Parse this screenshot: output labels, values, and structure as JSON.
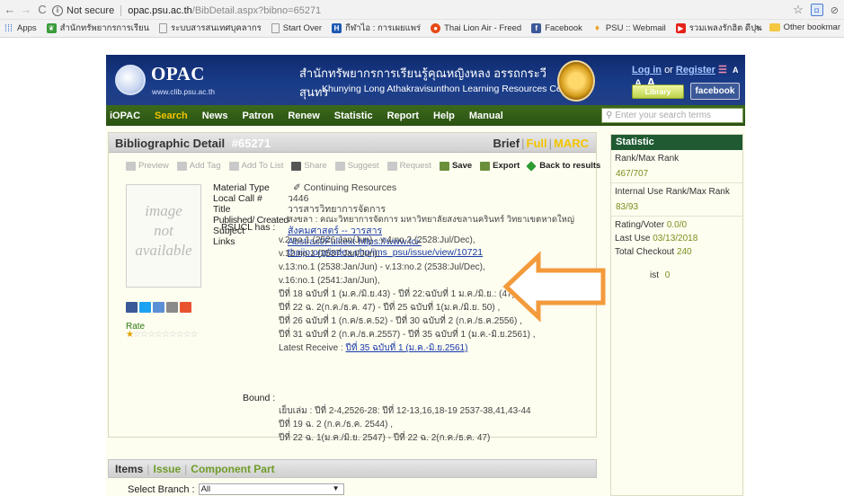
{
  "browser": {
    "nav_back": "←",
    "nav_forward": "→",
    "reload": "C",
    "security_label": "Not secure",
    "url_host": "opac.psu.ac.th",
    "url_path": "/BibDetail.aspx?bibno=65271",
    "bookmarks": [
      {
        "label": "Apps",
        "icon": "apps-grid-icon",
        "color": "#4a7bd0"
      },
      {
        "label": "สำนักทรัพยากรการเรียน",
        "icon": "leaf-icon",
        "color": "#3a9c3a"
      },
      {
        "label": "ระบบสารสนเทศบุคลากร",
        "icon": "page-icon",
        "color": "#999999"
      },
      {
        "label": "Start Over",
        "icon": "page-icon",
        "color": "#999999"
      },
      {
        "label": "กีฬาไอ : การเผยแพร่",
        "icon": "h-icon",
        "color": "#1e5ab4"
      },
      {
        "label": "Thai Lion Air - Freed",
        "icon": "lion-icon",
        "color": "#e64a19"
      },
      {
        "label": "Facebook",
        "icon": "facebook-icon",
        "color": "#3b5998"
      },
      {
        "label": "PSU :: Webmail",
        "icon": "psu-icon",
        "color": "#f0a020"
      },
      {
        "label": "รวมเพลงรักฮิต ดีปุน",
        "icon": "youtube-icon",
        "color": "#e62117"
      }
    ],
    "overflow": "»",
    "other_bookmarks": "Other bookmar"
  },
  "header": {
    "logo_title": "OPAC",
    "logo_url": "www.clib.psu.ac.th",
    "center_thai": "สำนักทรัพยากรการเรียนรู้คุณหญิงหลง อรรถกระวีสุนทร",
    "center_en": "Khunying Long Athakravisunthon Learning Resources Center",
    "login": "Log in",
    "or": "or",
    "register": "Register",
    "font_sizes": [
      "A",
      "A",
      "A"
    ],
    "library_badge": "Library",
    "facebook_badge": "facebook"
  },
  "menu": {
    "items": [
      "iOPAC",
      "Search",
      "News",
      "Patron",
      "Renew",
      "Statistic",
      "Report",
      "Help",
      "Manual"
    ],
    "active": "Search",
    "search_placeholder": "Enter your search terms"
  },
  "bib": {
    "title": "Bibliographic Detail",
    "bib_number": "#65271",
    "views": [
      "Brief",
      "Full",
      "MARC"
    ],
    "actions": [
      {
        "label": "Preview",
        "enabled": false
      },
      {
        "label": "Add Tag",
        "enabled": false
      },
      {
        "label": "Add To List",
        "enabled": false
      },
      {
        "label": "Share",
        "enabled": false
      },
      {
        "label": "Suggest",
        "enabled": false
      },
      {
        "label": "Request",
        "enabled": false
      },
      {
        "label": "Save",
        "enabled": true
      },
      {
        "label": "Export",
        "enabled": true
      },
      {
        "label": "Back to results",
        "enabled": true
      }
    ],
    "no_image": [
      "image",
      "not",
      "available"
    ],
    "rate_label": "Rate",
    "material_type_label": "Material Type",
    "material_type": "Continuing Resources",
    "local_call_label": "Local Call #",
    "local_call": "ว446",
    "title_label": "Title",
    "title_value": "วารสารวิทยาการจัดการ",
    "published_label": "Published/ Created",
    "published": "สงขลา : คณะวิทยาการจัดการ มหาวิทยาลัยสงขลานครินทร์ วิทยาเขตหาดใหญ่",
    "subject_label": "Subject",
    "subject": "สังคมศาสตร์ -- วารสาร",
    "links_label": "Links",
    "links_line1": "Abstract/Fulltext https://www.tci-",
    "links_line2": "thaijo.org/index.php/jms_psu/issue/view/10721",
    "psucl_label": "PSUCL has :",
    "holdings": [
      "v.2:no.1 (2526:Jan/Jun) - v.4:no.2 (2528:Jul/Dec),",
      "v.12:no.1 (2537:Jan/Jun),",
      "v.13:no.1 (2538:Jan/Jun) - v.13:no.2 (2538:Jul/Dec),",
      "v.16:no.1 (2541:Jan/Jun),",
      "ปีที่ 18 ฉบับที่ 1 (ม.ค./มิ.ย.43) - ปีที่ 22:ฉบับที่ 1 ม.ค./มิ.ย.: (47)",
      "ปีที่ 22 ฉ. 2(ก.ค./ธ.ค. 47) - ปีที่ 25 ฉบับที่ 1(ม.ค./มิ.ย. 50) ,",
      "ปีที่ 26 ฉบับที่ 1 (ก.ค/ธ.ค.52) - ปีที่ 30 ฉบับที่ 2 (ก.ค./ธ.ค.2556) ,",
      "ปีที่ 31 ฉบับที่ 2 (ก.ค./ธ.ค.2557) - ปีที่ 35 ฉบับที่ 1 (ม.ค.-มิ.ย.2561) ,"
    ],
    "latest_receive_label": "Latest Receive :",
    "latest_receive": "ปีที่ 35 ฉบับที่ 1 (ม.ค.-มิ.ย.2561)",
    "bound_label": "Bound :",
    "bound": [
      "เย็บเล่ม : ปีที่ 2-4,2526-28: ปีที่ 12-13,16,18-19 2537-38,41,43-44",
      "ปีที่ 19 ฉ. 2 (ก.ค./ธ.ค. 2544) ,",
      "ปีที่ 22 ฉ. 1(ม.ค./มิ.ย. 2547) - ปีที่ 22 ฉ. 2(ก.ค./ธ.ค. 47)"
    ]
  },
  "stats": {
    "title": "Statistic",
    "rank_label": "Rank/Max Rank",
    "rank": "467/707",
    "internal_label": "Internal Use Rank/Max Rank",
    "internal": "83/93",
    "rating_label": "Rating/Voter",
    "rating": "0.0/0",
    "last_use_label": "Last Use",
    "last_use": "03/13/2018",
    "checkout_label": "Total Checkout",
    "checkout": "240",
    "list_label": "ist",
    "list_value": "0"
  },
  "items": {
    "tabs": [
      "Items",
      "Issue",
      "Component Part"
    ],
    "branch_label": "Select Branch :",
    "branch_value": "All"
  },
  "colors": {
    "banner": "#1a3d8a",
    "menubar": "#2f5a16",
    "active_menu": "#f2c400",
    "stats_header": "#1f5a32",
    "arrow": "#f39a3c"
  }
}
